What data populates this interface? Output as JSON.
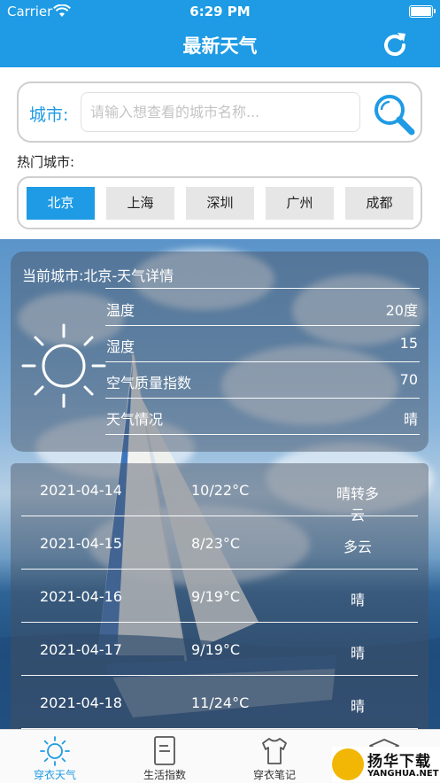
{
  "status_bar": {
    "carrier": "Carrier",
    "time": "6:29 PM"
  },
  "nav": {
    "title": "最新天气",
    "refresh_icon": "refresh-icon"
  },
  "search": {
    "label": "城市:",
    "placeholder": "请输入想查看的城市名称...",
    "value": "",
    "icon": "search-icon"
  },
  "hot_cities": {
    "label": "热门城市:",
    "items": [
      "北京",
      "上海",
      "深圳",
      "广州",
      "成都"
    ],
    "selected": "北京"
  },
  "current": {
    "title": "当前城市:北京-天气详情",
    "icon": "sun-icon",
    "rows": [
      {
        "key": "温度",
        "value": "20度"
      },
      {
        "key": "湿度",
        "value": "15"
      },
      {
        "key": "空气质量指数",
        "value": "70"
      },
      {
        "key": "天气情况",
        "value": "晴"
      }
    ]
  },
  "forecast": [
    {
      "date": "2021-04-14",
      "temp": "10/22°C",
      "weather": "晴转多云"
    },
    {
      "date": "2021-04-15",
      "temp": "8/23°C",
      "weather": "多云"
    },
    {
      "date": "2021-04-16",
      "temp": "9/19°C",
      "weather": "晴"
    },
    {
      "date": "2021-04-17",
      "temp": "9/19°C",
      "weather": "晴"
    },
    {
      "date": "2021-04-18",
      "temp": "11/24°C",
      "weather": "晴"
    }
  ],
  "tabbar": {
    "items": [
      {
        "label": "穿衣天气",
        "icon": "sun-icon"
      },
      {
        "label": "生活指数",
        "icon": "document-icon"
      },
      {
        "label": "穿衣笔记",
        "icon": "tshirt-icon"
      },
      {
        "label": "",
        "icon": "graduation-cap-icon"
      }
    ],
    "active_index": 0
  },
  "watermark": {
    "name": "扬华下载",
    "url": "YANGHUA.NET"
  },
  "colors": {
    "accent": "#1e9be4",
    "chip_bg": "#e6e6e6",
    "panel": "rgba(70,80,95,0.45)"
  }
}
